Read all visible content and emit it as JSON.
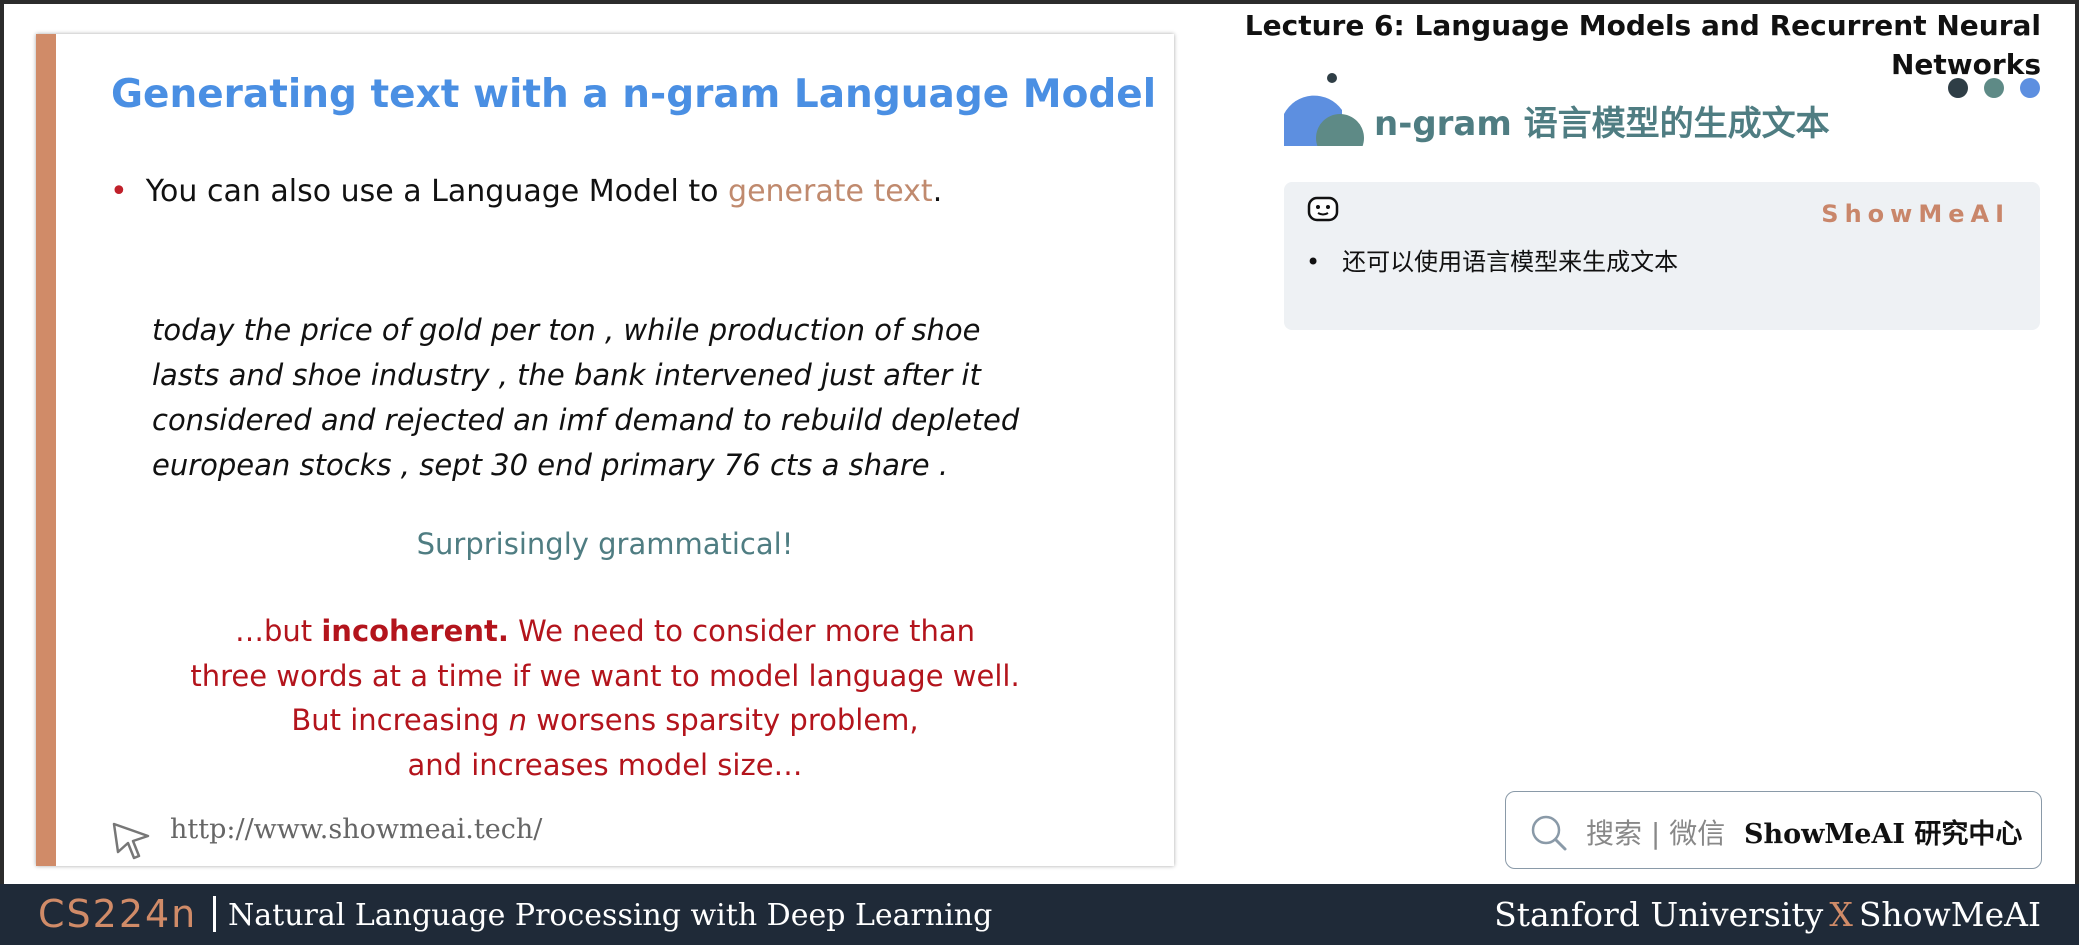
{
  "slide": {
    "title": "Generating text with a n-gram Language Model",
    "bullet_prefix": "You can also use a Language Model to ",
    "bullet_accent": "generate text",
    "bullet_suffix": ".",
    "sample_lines": [
      "today the price of gold per ton , while production of shoe",
      "lasts and shoe industry , the bank intervened just after it",
      "considered and rejected an imf demand to rebuild depleted",
      "european stocks , sept 30 end primary 76 cts a share ."
    ],
    "grammatical": "Surprisingly grammatical!",
    "incoherent_pre": "…but ",
    "incoherent_bold": "incoherent.",
    "incoherent_post": " We need to consider more than",
    "incoherent_line2": "three words at a time if we want to model language well.",
    "sparsity_pre": "But increasing ",
    "sparsity_n": "n",
    "sparsity_post": " worsens sparsity problem,",
    "sparsity_line2": "and increases model size…",
    "url": "http://www.showmeai.tech/"
  },
  "header": {
    "lecture_line1": "Lecture 6:  Language Models and Recurrent Neural",
    "lecture_line2": "Networks",
    "section_title": "n-gram 语言模型的生成文本"
  },
  "note": {
    "brand": "ShowMeAI",
    "bullet": "•",
    "text": "还可以使用语言模型来生成文本"
  },
  "search": {
    "hint": "搜索 | 微信",
    "brand": "ShowMeAI 研究中心"
  },
  "footer": {
    "course_code": "CS224n",
    "course_name": "Natural Language Processing with Deep Learning",
    "university": "Stanford University",
    "x": "X",
    "partner": "ShowMeAI"
  },
  "colors": {
    "accent_orange": "#d08b68",
    "title_blue": "#4a8fe3",
    "teal": "#4f7d82",
    "red": "#b3141c",
    "footer_bg": "#1f2a38",
    "dot_dark": "#2f3e46",
    "dot_teal": "#5e8a86",
    "dot_blue": "#5d8fe0"
  }
}
